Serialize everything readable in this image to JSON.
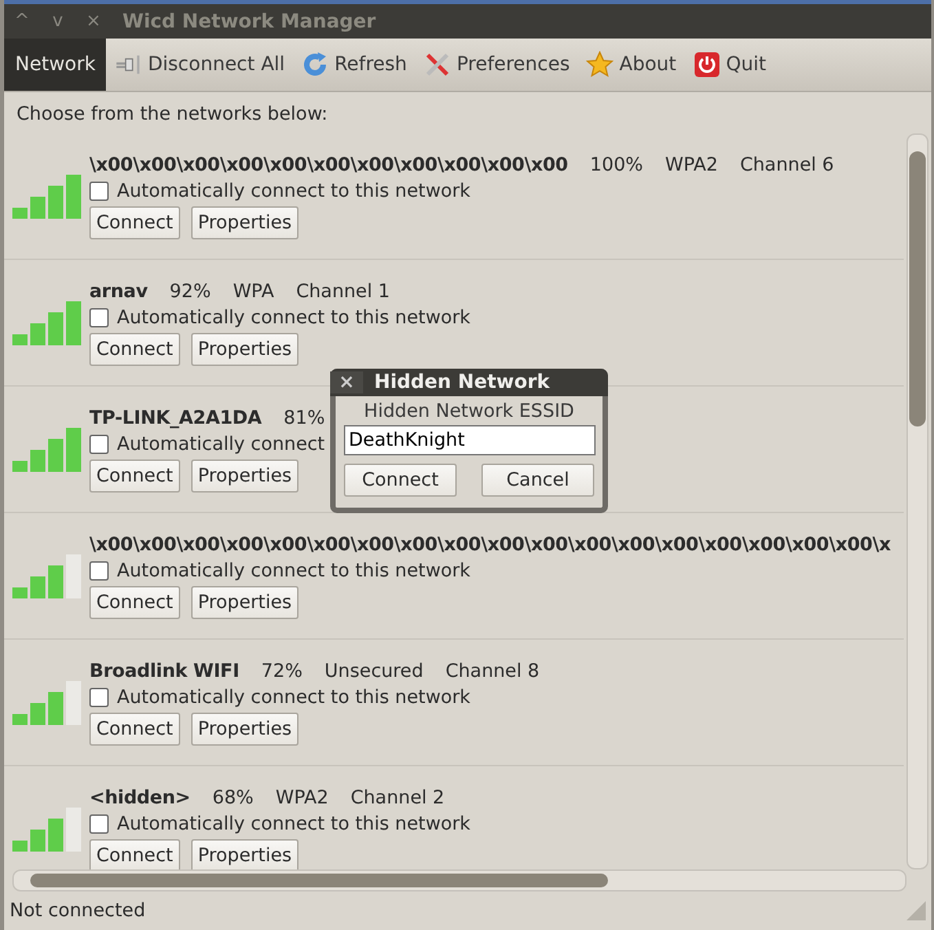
{
  "window": {
    "title": "Wicd Network Manager",
    "controls": [
      "^",
      "v",
      "×"
    ]
  },
  "toolbar": [
    {
      "label": "Network",
      "kind": "menu",
      "selected": true
    },
    {
      "label": "Disconnect All",
      "kind": "plug"
    },
    {
      "label": "Refresh",
      "kind": "refresh"
    },
    {
      "label": "Preferences",
      "kind": "tools"
    },
    {
      "label": "About",
      "kind": "star"
    },
    {
      "label": "Quit",
      "kind": "power"
    }
  ],
  "prompt": "Choose from the networks below:",
  "networks": [
    {
      "name": "\\x00\\x00\\x00\\x00\\x00\\x00\\x00\\x00\\x00\\x00\\x00",
      "details": [
        "100%",
        "WPA2",
        "Channel 6"
      ],
      "kind": "four_bars",
      "auto_label": "Automatically connect to this network",
      "checked": false,
      "buttons": [
        "Connect",
        "Properties"
      ]
    },
    {
      "name": "arnav",
      "details": [
        "92%",
        "WPA",
        "Channel 1"
      ],
      "kind": "four_bars",
      "auto_label": "Automatically connect to this network",
      "checked": false,
      "buttons": [
        "Connect",
        "Properties"
      ]
    },
    {
      "name": "TP-LINK_A2A1DA",
      "details": [
        "81%"
      ],
      "kind": "four_bars",
      "auto_label": "Automatically connect",
      "checked": false,
      "buttons": [
        "Connect",
        "Properties"
      ]
    },
    {
      "name": "\\x00\\x00\\x00\\x00\\x00\\x00\\x00\\x00\\x00\\x00\\x00\\x00\\x00\\x00\\x00\\x00\\x00\\x00\\x",
      "kind": "three_bars",
      "auto_label": "Automatically connect to this network",
      "checked": false,
      "buttons": [
        "Connect",
        "Properties"
      ]
    },
    {
      "name": "Broadlink WIFI",
      "details": [
        "72%",
        "Unsecured",
        "Channel 8"
      ],
      "kind": "three_bars",
      "auto_label": "Automatically connect to this network",
      "checked": false,
      "buttons": [
        "Connect",
        "Properties"
      ]
    },
    {
      "name": "<hidden>",
      "details": [
        "68%",
        "WPA2",
        "Channel 2"
      ],
      "kind": "three_bars",
      "auto_label": "Automatically connect to this network",
      "checked": false,
      "buttons": [
        "Connect",
        "Properties"
      ]
    }
  ],
  "dialog": {
    "title": "Hidden Network",
    "close": "×",
    "label": "Hidden Network ESSID",
    "value": "DeathKnight",
    "buttons": [
      "Connect",
      "Cancel"
    ]
  },
  "status_bar": "Not connected"
}
